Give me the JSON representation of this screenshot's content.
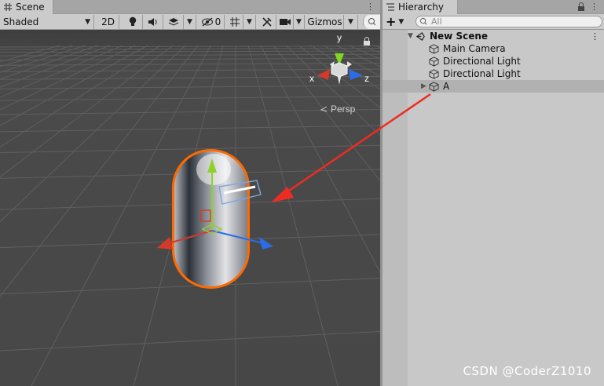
{
  "scene": {
    "tab_label": "Scene",
    "shading_mode": "Shaded",
    "mode_2d_label": "2D",
    "hidden_count": "0",
    "gizmos_label": "Gizmos",
    "view_axes": {
      "x": "x",
      "y": "y",
      "z": "z"
    },
    "projection_label": "Persp"
  },
  "hierarchy": {
    "tab_label": "Hierarchy",
    "search_placeholder": "All",
    "scene_name": "New Scene",
    "items": [
      {
        "label": "Main Camera"
      },
      {
        "label": "Directional Light"
      },
      {
        "label": "Directional Light"
      },
      {
        "label": "A"
      }
    ]
  },
  "watermark": "CSDN @CoderZ1010",
  "colors": {
    "viewport_bg": "#474747",
    "panel_bg": "#c8c8c8",
    "selection_outline": "#ff6a00",
    "annotation_arrow": "#ee2c22",
    "axis_x": "#d6392a",
    "axis_y": "#8fd12a",
    "axis_z": "#2c6ce8"
  }
}
